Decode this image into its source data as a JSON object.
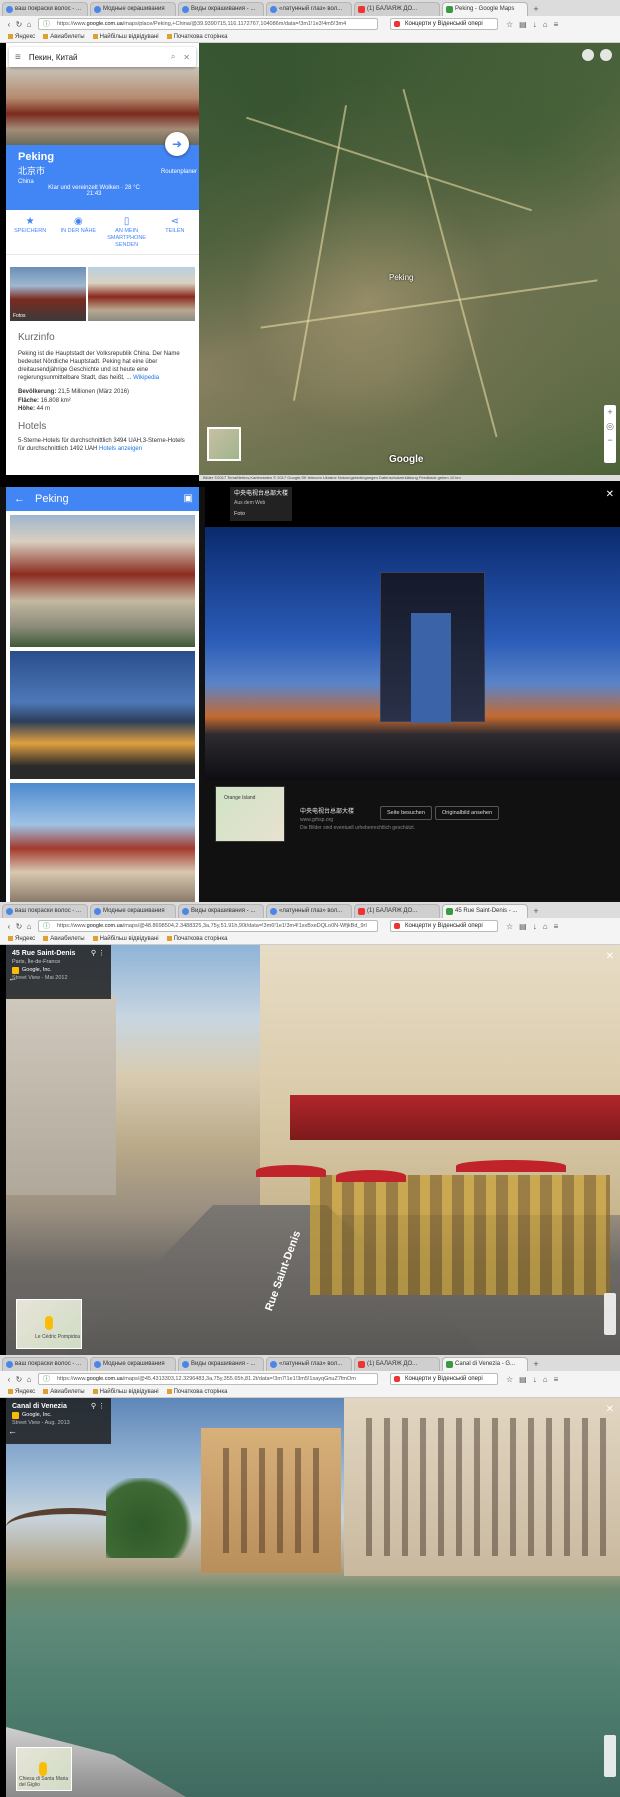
{
  "browser": {
    "tabs_shot1": [
      {
        "label": "ваш покраски волос - ...",
        "active": false,
        "icon": "google-favicon"
      },
      {
        "label": "Модные окрашивания",
        "active": false,
        "icon": "google-favicon"
      },
      {
        "label": "Виды окрашивания - ...",
        "active": false,
        "icon": "google-favicon"
      },
      {
        "label": "«латунный глаз» вол...",
        "active": false,
        "icon": "google-favicon"
      },
      {
        "label": "(1) БАЛАЯЖ ДО...",
        "active": false,
        "icon": "youtube-favicon"
      },
      {
        "label": "Peking - Google Maps",
        "active": true,
        "icon": "maps-favicon"
      }
    ],
    "tabs_shot3": [
      {
        "label": "ваш покраски волос - ...",
        "active": false,
        "icon": "google-favicon"
      },
      {
        "label": "Модные окрашивания",
        "active": false,
        "icon": "google-favicon"
      },
      {
        "label": "Виды окрашивания - ...",
        "active": false,
        "icon": "google-favicon"
      },
      {
        "label": "«латунный глаз» вол...",
        "active": false,
        "icon": "google-favicon"
      },
      {
        "label": "(1) БАЛАЯЖ ДО...",
        "active": false,
        "icon": "youtube-favicon"
      },
      {
        "label": "45 Rue Saint-Denis - ...",
        "active": true,
        "icon": "maps-favicon"
      }
    ],
    "tabs_shot4": [
      {
        "label": "ваш покраски волос - ...",
        "active": false,
        "icon": "google-favicon"
      },
      {
        "label": "Модные окрашивания",
        "active": false,
        "icon": "google-favicon"
      },
      {
        "label": "Виды окрашивания - ...",
        "active": false,
        "icon": "google-favicon"
      },
      {
        "label": "«латунный глаз» вол...",
        "active": false,
        "icon": "google-favicon"
      },
      {
        "label": "(1) БАЛАЯЖ ДО...",
        "active": false,
        "icon": "youtube-favicon"
      },
      {
        "label": "Canal di Venezia - G...",
        "active": true,
        "icon": "maps-favicon"
      }
    ],
    "new_tab": "+",
    "url_shot1_prefix": "https://www.",
    "url_shot1_host": "google.com.ua",
    "url_shot1_rest": "/maps/place/Peking,+China/@39.9390715,116.1172767,104086m/data=!3m1!1e3!4m5!3m4",
    "url_shot3_prefix": "https://www.",
    "url_shot3_host": "google.com.ua",
    "url_shot3_rest": "/maps/@48.8698504,2.3488325,3a,75y,51.91h,90t/data=!3m6!1e1!3m4!1sxBxeDQLo0N-WfjkBd_9rI",
    "url_shot4_prefix": "https://www.",
    "url_shot4_host": "google.com.ua",
    "url_shot4_rest": "/maps/@45.4313303,12.3296483,3a,75y,355.65h,81.2t/data=!3m7!1e1!3m5!1sayqGnuZ7fmOm",
    "search_box": "Концерти у Віденській опері",
    "bookmarks": [
      "Яндекс",
      "Авиабилеты",
      "Найбільш відвідувані",
      "Початкова сторінка"
    ]
  },
  "maps": {
    "search_query": "Пекин, Китай",
    "place_name": "Peking",
    "place_name_zh": "北京市",
    "country": "China",
    "weather": "Klar und vereinzelt Wolken · 28 °C",
    "weather_time": "21:43",
    "route_label": "Routenplaner",
    "actions": [
      {
        "icon": "star-icon",
        "glyph": "★",
        "label": "SPEICHERN"
      },
      {
        "icon": "nearby-icon",
        "glyph": "◉",
        "label": "IN DER NÄHE"
      },
      {
        "icon": "phone-icon",
        "glyph": "▯",
        "label": "AN MEIN SMARTPHONE SENDEN"
      },
      {
        "icon": "share-icon",
        "glyph": "⋖",
        "label": "TEILEN"
      }
    ],
    "photo_label": "Fotos",
    "kurzinfo_title": "Kurzinfo",
    "kurzinfo_text": "Peking ist die Hauptstadt der Volksrepublik China. Der Name bedeutet Nördliche Hauptstadt. Peking hat eine über dreitausendjährige Geschichte und ist heute eine regierungsunmittelbare Stadt, das heißt, ...",
    "kurzinfo_link": "Wikipedia",
    "facts": [
      {
        "k": "Bevölkerung:",
        "v": "21,5 Millionen (März 2016)"
      },
      {
        "k": "Fläche:",
        "v": "16.808 km²"
      },
      {
        "k": "Höhe:",
        "v": "44 m"
      }
    ],
    "hotels_title": "Hotels",
    "hotels_text": "5-Sterne-Hotels für durchschnittlich 3494 UAH,3-Sterne-Hotels für durchschnittlich 1492 UAH",
    "hotels_link": "Hotels anzeigen",
    "map_label": "Peking",
    "map_brand": "Google",
    "map_footer": "Bilder ©2017 TerraMetrics,Kartendaten © 2017 Google,SK telecom   Ukraine   Nutzungsbedingungen   Datenschutzerklärung   Feedback geben   10 km"
  },
  "lightbox": {
    "header_title": "Peking",
    "info_title": "中央电视台总部大楼",
    "info_sub": "Aus dem Web",
    "info_foto": "Foto",
    "caption_title": "中央电视台总部大楼",
    "caption_url": "www.grhsp.org",
    "caption_note": "Die Bilder sind eventuell urheberrechtlich geschützt.",
    "btn_visit": "Seite besuchen",
    "btn_original": "Originalbild ansehen",
    "minimap_label": "Orange Island"
  },
  "streetview_paris": {
    "title": "45 Rue Saint-Denis",
    "subtitle": "Paris, Île-de-France",
    "owner": "Google, Inc.",
    "date": "Street View - Mai 2012",
    "street_sign": "Rue Saint-Denis",
    "minimap_label": "Le Cédric Pompidou"
  },
  "streetview_venice": {
    "title": "Canal di Venezia",
    "owner": "Google, Inc.",
    "date": "Street View - Aug. 2013",
    "minimap_label": "Chiesa di Santa Maria del Giglio"
  },
  "colors": {
    "maps_blue": "#4285f4",
    "chrome_tab": "#dcdcdc",
    "link": "#1a73e8"
  }
}
